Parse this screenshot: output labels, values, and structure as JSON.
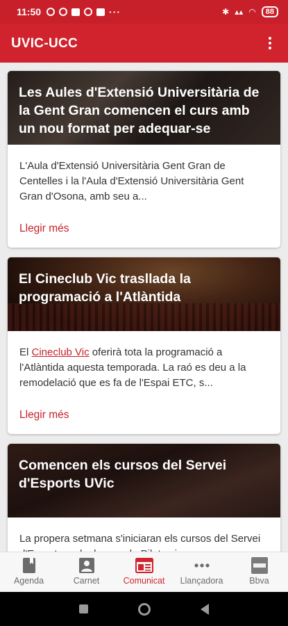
{
  "status_bar": {
    "time": "11:50",
    "battery": "88",
    "more": "···"
  },
  "app_bar": {
    "logo_mark": "U",
    "title": "VIC-UCC"
  },
  "articles": [
    {
      "title": "Les Aules d'Extensió Universitària de la Gent Gran comencen el curs amb un nou format per adequar-se",
      "excerpt": "L'Aula d'Extensió Universitària Gent Gran de Centelles i la l'Aula d'Extensió Universitària Gent Gran d'Osona, amb seu a...",
      "more_label": "Llegir més"
    },
    {
      "title": "El Cineclub Vic trasllada la programació a l'Atlàntida",
      "excerpt_before": "El ",
      "excerpt_link": "Cineclub Vic",
      "excerpt_after": " oferirà tota la programació a l'Atlàntida aquesta temporada. La raó es deu a la remodelació que es fa de l'Espai ETC, s...",
      "more_label": "Llegir més"
    },
    {
      "title": "Comencen els cursos del Servei d'Esports UVic",
      "excerpt": "La propera setmana s'iniciaran els cursos del Servei d'Esports amb classes de Pilates i..."
    }
  ],
  "bottom_nav": [
    {
      "label": "Agenda",
      "icon": "bookmark-book-icon"
    },
    {
      "label": "Carnet",
      "icon": "id-card-icon"
    },
    {
      "label": "Comunicat",
      "icon": "newspaper-icon",
      "active": true
    },
    {
      "label": "Llançadora",
      "icon": "more-horiz-icon"
    },
    {
      "label": "Bbva",
      "icon": "bbva-icon"
    }
  ],
  "colors": {
    "brand": "#d0232e",
    "status": "#c8202a",
    "nav_inactive": "#6b6b6b"
  }
}
